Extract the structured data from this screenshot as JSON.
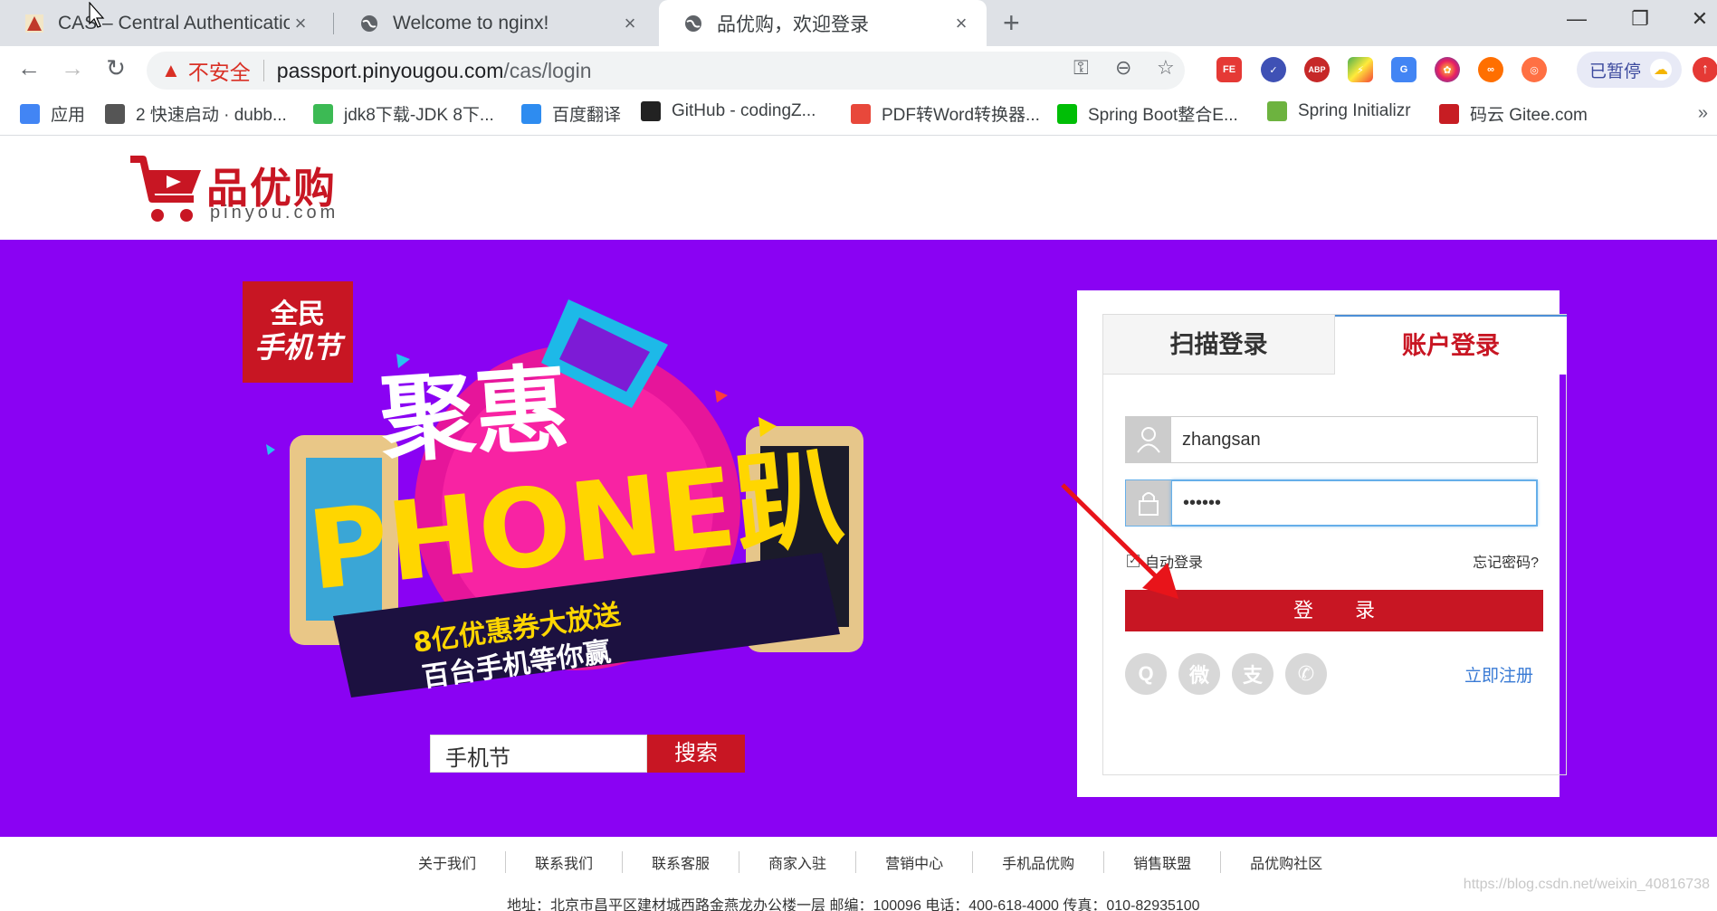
{
  "tabs": [
    {
      "title": "CAS – Central Authentication S",
      "close": "×"
    },
    {
      "title": "Welcome to nginx!",
      "close": "×"
    },
    {
      "title": "品优购，欢迎登录",
      "close": "×"
    }
  ],
  "window": {
    "minimize": "—",
    "restore": "❐",
    "close": "✕",
    "new_tab": "+"
  },
  "address": {
    "security_label": "不安全",
    "host": "passport.pinyougou.com",
    "path": "/cas/login"
  },
  "toolbar": {
    "paused_label": "已暂停"
  },
  "bookmarks": [
    {
      "label": "应用",
      "icon": "apps-grid-icon",
      "color": "#4285f4"
    },
    {
      "label": "2 快速启动 · dubb...",
      "icon": "book-icon",
      "color": "#555555"
    },
    {
      "label": "jdk8下载-JDK 8下...",
      "icon": "java-icon",
      "color": "#3cba54"
    },
    {
      "label": "百度翻译",
      "icon": "translate-icon",
      "color": "#2e8cf0"
    },
    {
      "label": "GitHub - codingZ...",
      "icon": "github-icon",
      "color": "#222222"
    },
    {
      "label": "PDF转Word转换器...",
      "icon": "pdf-icon",
      "color": "#e8483b"
    },
    {
      "label": "Spring Boot整合E...",
      "icon": "iqiyi-icon",
      "color": "#00be06"
    },
    {
      "label": "Spring Initializr",
      "icon": "spring-icon",
      "color": "#6db33f"
    },
    {
      "label": "码云 Gitee.com",
      "icon": "gitee-icon",
      "color": "#c71d23"
    }
  ],
  "logo": {
    "cn": "品优购",
    "en": "pinyou.com"
  },
  "banner": {
    "search_value": "手机节",
    "search_button": "搜索"
  },
  "login": {
    "tab_scan": "扫描登录",
    "tab_account": "账户登录",
    "username": "zhangsan",
    "password": "••••••",
    "remember": "自动登录",
    "forgot": "忘记密码?",
    "submit": "登 录",
    "register": "立即注册",
    "social": [
      {
        "name": "qq-icon",
        "glyph": "Q"
      },
      {
        "name": "weibo-icon",
        "glyph": "微"
      },
      {
        "name": "alipay-icon",
        "glyph": "支"
      },
      {
        "name": "wechat-icon",
        "glyph": "✆"
      }
    ]
  },
  "footer": {
    "links": [
      "关于我们",
      "联系我们",
      "联系客服",
      "商家入驻",
      "营销中心",
      "手机品优购",
      "销售联盟",
      "品优购社区"
    ],
    "address": "地址：北京市昌平区建材城西路金燕龙办公楼一层 邮编：100096 电话：400-618-4000 传真：010-82935100",
    "watermark": "https://blog.csdn.net/weixin_40816738"
  },
  "colors": {
    "brand_red": "#c81623",
    "banner_purple": "#8a02f3",
    "link_blue": "#3a7bd5",
    "arrow_red": "#e8141a"
  }
}
